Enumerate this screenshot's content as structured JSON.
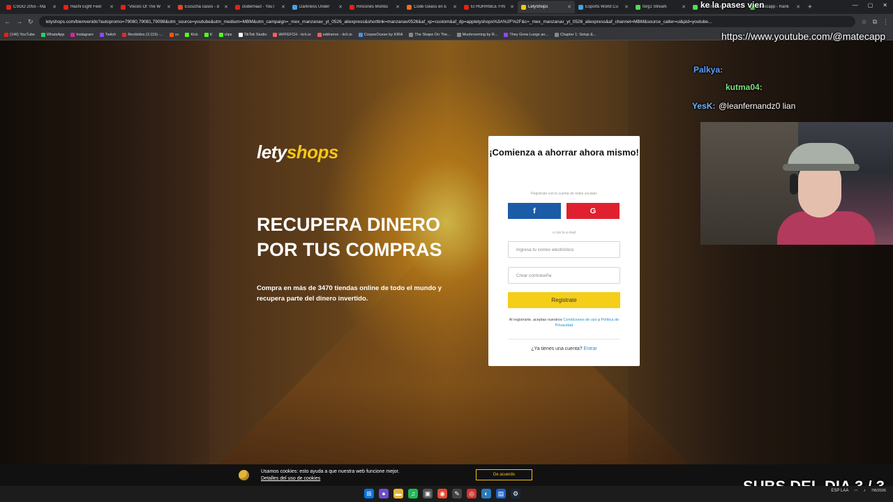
{
  "browser": {
    "tabs": [
      {
        "label": "CSGO 2055 - Ma",
        "color": "#e62117"
      },
      {
        "label": "Hachi Eight Feel",
        "color": "#e62117"
      },
      {
        "label": "\"Voices Of The W",
        "color": "#e62117"
      },
      {
        "label": "Escucha casos - d",
        "color": "#e2452b"
      },
      {
        "label": "clubernaut - YouT",
        "color": "#e62117"
      },
      {
        "label": "Darkness Under",
        "color": "#4aa3df"
      },
      {
        "label": "Rincones Moribu",
        "color": "#e62117"
      },
      {
        "label": "Code Geass en E",
        "color": "#f26b1d"
      },
      {
        "label": "El HORRIBLE FIN",
        "color": "#e62117"
      },
      {
        "label": "LetyShops",
        "color": "#f5c518",
        "active": true
      },
      {
        "label": "Esports World Cu",
        "color": "#4aa3df"
      },
      {
        "label": "forg1 Stream",
        "color": "#4fdd57"
      },
      {
        "label": "Twitter | Sub",
        "color": "#4fdd57"
      },
      {
        "label": "Matecapp - Rank",
        "color": "#4fdd57"
      }
    ],
    "url": "letyshops.com/bienvenido?autopromo=79080,79081,79098&utm_source=youtube&utm_medium=MBM&utm_campaign=_mex_manzanav_yt_0526_aliexpress&shortlink=manzanav0526&af_xp=custom&af_dp=appletyshops%3A%2F%2F&c=_mex_manzanav_yt_0526_aliexpress&af_channel=MBM&source_caller=ui&pid=youtube...",
    "bookmarks": [
      {
        "label": "(146) YouTube",
        "color": "#e62117"
      },
      {
        "label": "WhatsApp",
        "color": "#25d366"
      },
      {
        "label": "Instagram",
        "color": "#d6249f"
      },
      {
        "label": "Twitch",
        "color": "#9146ff"
      },
      {
        "label": "Recibidos (3.119) -...",
        "color": "#d93025"
      },
      {
        "label": "sc",
        "color": "#ff5500"
      },
      {
        "label": "Kick",
        "color": "#53fc18"
      },
      {
        "label": "K",
        "color": "#53fc18"
      },
      {
        "label": "clips",
        "color": "#53fc18"
      },
      {
        "label": "TikTok Studio",
        "color": "#ffffff"
      },
      {
        "label": "IAFFEFCH - itch.io",
        "color": "#fa5c5c"
      },
      {
        "label": "oddnerve - itch.io",
        "color": "#fa5c5c"
      },
      {
        "label": "CorpseOcean by KIRA",
        "color": "#4a90e2"
      },
      {
        "label": "The Shape On The...",
        "color": "#888888"
      },
      {
        "label": "Mushrooming by R...",
        "color": "#888888"
      },
      {
        "label": "They Grew Lungs an...",
        "color": "#9146ff"
      },
      {
        "label": "Chapter 1: Setup &...",
        "color": "#888888"
      }
    ]
  },
  "hero": {
    "logo_lety": "lety",
    "logo_shops": "shops",
    "headline": "RECUPERA DINERO POR TUS COMPRAS",
    "subline": "Compra en más de 3470 tiendas online de todo el mundo y recupera parte del dinero invertido."
  },
  "signup": {
    "title": "¡Comienza a ahorrar ahora mismo!",
    "social_note": "Regístrate con tu cuenta de redes sociales",
    "facebook_label": "f",
    "google_label": "G",
    "or_email": "o con tu e-mail",
    "email_placeholder": "Ingresa tu correo electrónico",
    "password_placeholder": "Crear contraseña",
    "submit_label": "Registrate",
    "terms_prefix": "Al registrarte, aceptas nuestros",
    "terms_link": "Condiciones de uso",
    "terms_and": "y",
    "privacy_link": "Política de Privacidad",
    "login_prompt": "¿Ya tienes una cuenta?",
    "login_link": "Entrar"
  },
  "cookie": {
    "text": "Usamos cookies: esto ayuda a que nuestra web funcione mejor.",
    "link": "Detalles del uso de cookies",
    "button": "De acuerdo"
  },
  "stream": {
    "top_line": "ke la pases vien",
    "url_overlay": "https://www.youtube.com/@matecapp",
    "chat": [
      {
        "user": "Palkya:",
        "message": ""
      },
      {
        "user": "kutma04:",
        "message": ""
      },
      {
        "user": "YesK:",
        "message": "@leanfernandz0 lian"
      }
    ],
    "subs": "SUBS DEL DIA 3 / 3"
  },
  "taskbar": {
    "lang": "ESP LAA",
    "date": "7/8/2026"
  }
}
